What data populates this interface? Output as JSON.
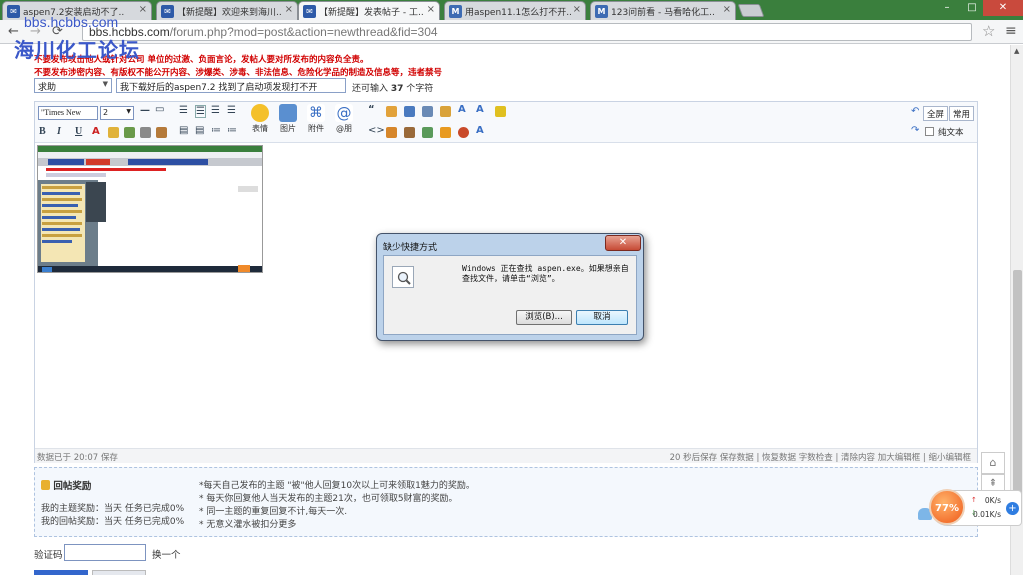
{
  "colors": {
    "tabbar_bg": "#3a7f3d",
    "warning_text": "#d10000",
    "watermark": "#3b58c9",
    "dialog_frame": "#bcd2ea"
  },
  "browser": {
    "tabs": [
      {
        "label": "aspen7.2安装启动不了..",
        "icon": "forum-icon"
      },
      {
        "label": "【新提醒】欢迎来到海川..",
        "icon": "forum-icon"
      },
      {
        "label": "【新提醒】发表帖子 - 工..",
        "icon": "forum-icon",
        "active": true
      },
      {
        "label": "用aspen11.1怎么打不开..",
        "icon": "m-icon"
      },
      {
        "label": "123问前看 - 马看哈化工..",
        "icon": "m-icon"
      }
    ],
    "url_host": "bbs.hcbbs.com",
    "url_path": "/forum.php?mod=post&action=newthread&fid=304",
    "window_controls": [
      "–",
      "□",
      "✕"
    ]
  },
  "watermark": {
    "line1": "bbs.hcbbs.com",
    "line2": "海川化工论坛"
  },
  "notices": [
    "不要发布攻击他人或针对公司 单位的过激、负面言论，发帖人要对所发布的内容负全责。",
    "不要发布涉密内容、有版权不能公开内容、涉爆类、涉毒、非法信息、危险化学品的制造及信息等，违者禁号"
  ],
  "form": {
    "category": "求助",
    "title_value": "我下载好后的aspen7.2 找到了启动项发现打不开",
    "remaining_prefix": "还可输入",
    "remaining_count": "37",
    "remaining_suffix": "个字符"
  },
  "editor": {
    "font": "\"Times New",
    "size": "2",
    "format_buttons": [
      "B",
      "I",
      "U",
      "A"
    ],
    "big_buttons": [
      {
        "label": "表情",
        "icon": "smiley-icon"
      },
      {
        "label": "图片",
        "icon": "image-icon"
      },
      {
        "label": "附件",
        "icon": "paperclip-icon"
      },
      {
        "label": "@朋",
        "icon": "at-icon"
      }
    ],
    "fullscreen": "全屏",
    "common": "常用",
    "plain_text": "纯文本",
    "status_left": "数据已于 20:07 保存",
    "status_right": "20 秒后保存 保存数据 | 恢复数据    字数检查 | 清除内容    加大编辑框 | 缩小编辑框"
  },
  "reward": {
    "title": "回帖奖励",
    "my_topic": "我的主题奖励：当天 任务已完成0%",
    "my_reply": "我的回帖奖励：当天 任务已完成0%",
    "tips": [
      "*每天自己发布的主题 \"被\"他人回复10次以上可来领取1魅力的奖励。",
      "* 每天你回复他人当天发布的主题21次，也可领取5财富的奖励。",
      "* 同一主题的重复回复不计,每天一次.",
      "* 无意义灌水被扣分更多"
    ]
  },
  "captcha": {
    "label": "验证码",
    "change": "换一个"
  },
  "net_widget": {
    "percent": "77%",
    "up": "0K/s",
    "down": "0.01K/s"
  },
  "dialog": {
    "title": "缺少快捷方式",
    "message": "Windows 正在查找 aspen.exe。如果想亲自查找文件，请单击“浏览”。",
    "browse": "浏览(B)...",
    "cancel": "取消"
  }
}
